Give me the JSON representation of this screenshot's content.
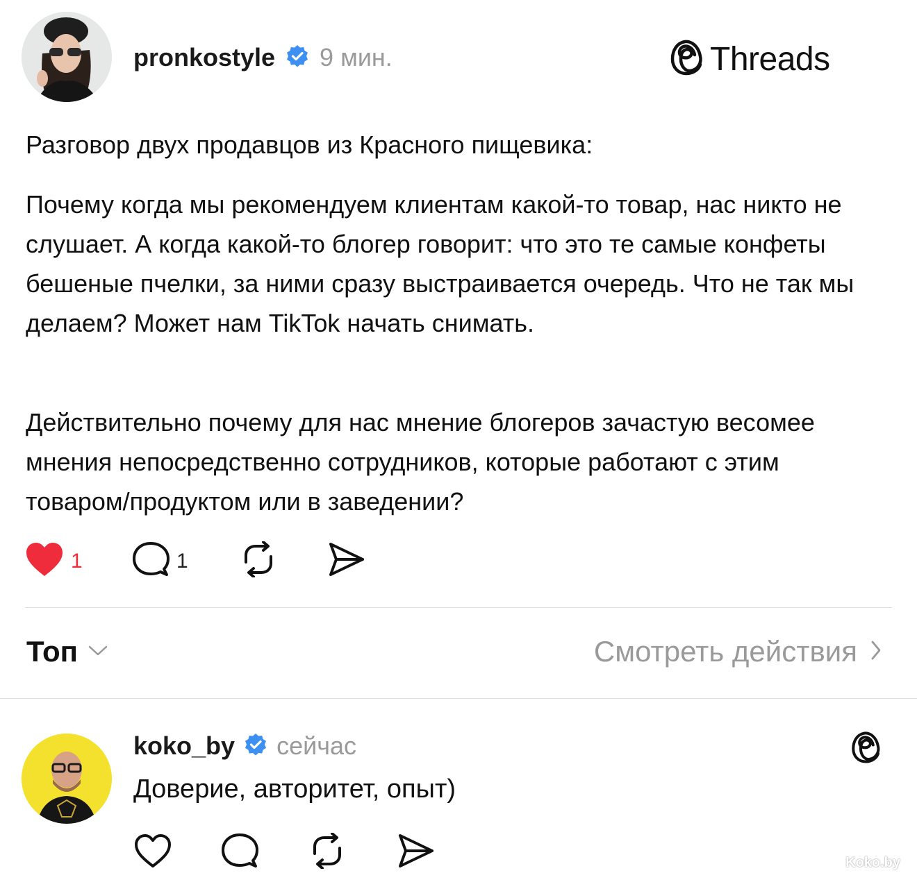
{
  "post": {
    "username": "pronkostyle",
    "time": "9 мин.",
    "paragraphs": [
      "Разговор двух продавцов из Красного пищевика:",
      "Почему когда мы рекомендуем клиентам какой-то товар, нас никто не слушает. А когда какой-то блогер говорит: что это те самые конфеты бешеные пчелки, за ними сразу выстраивается очередь. Что не так мы делаем? Может нам TikTok начать снимать.",
      "Действительно почему для нас мнение блогеров зачастую весомее мнения непосредственно сотрудников, которые работают с этим товаром/продуктом или в заведении?"
    ],
    "likes": "1",
    "replies": "1",
    "like_color": "#ee2c3c"
  },
  "brand": {
    "name": "Threads"
  },
  "sort": {
    "label": "Топ",
    "view_activity": "Смотреть действия"
  },
  "reply": {
    "username": "koko_by",
    "time": "сейчас",
    "text": "Доверие, авторитет, опыт)"
  },
  "watermark": "Koko.by",
  "icons": {
    "verified": "verified-badge-icon",
    "like": "heart-icon",
    "comment": "comment-bubble-icon",
    "repost": "repost-icon",
    "share": "share-send-icon",
    "threads": "threads-logo-icon",
    "chevron_down": "chevron-down-icon",
    "chevron_right": "chevron-right-icon"
  },
  "colors": {
    "verified": "#3d8ff2",
    "muted": "#9a9a9a"
  }
}
